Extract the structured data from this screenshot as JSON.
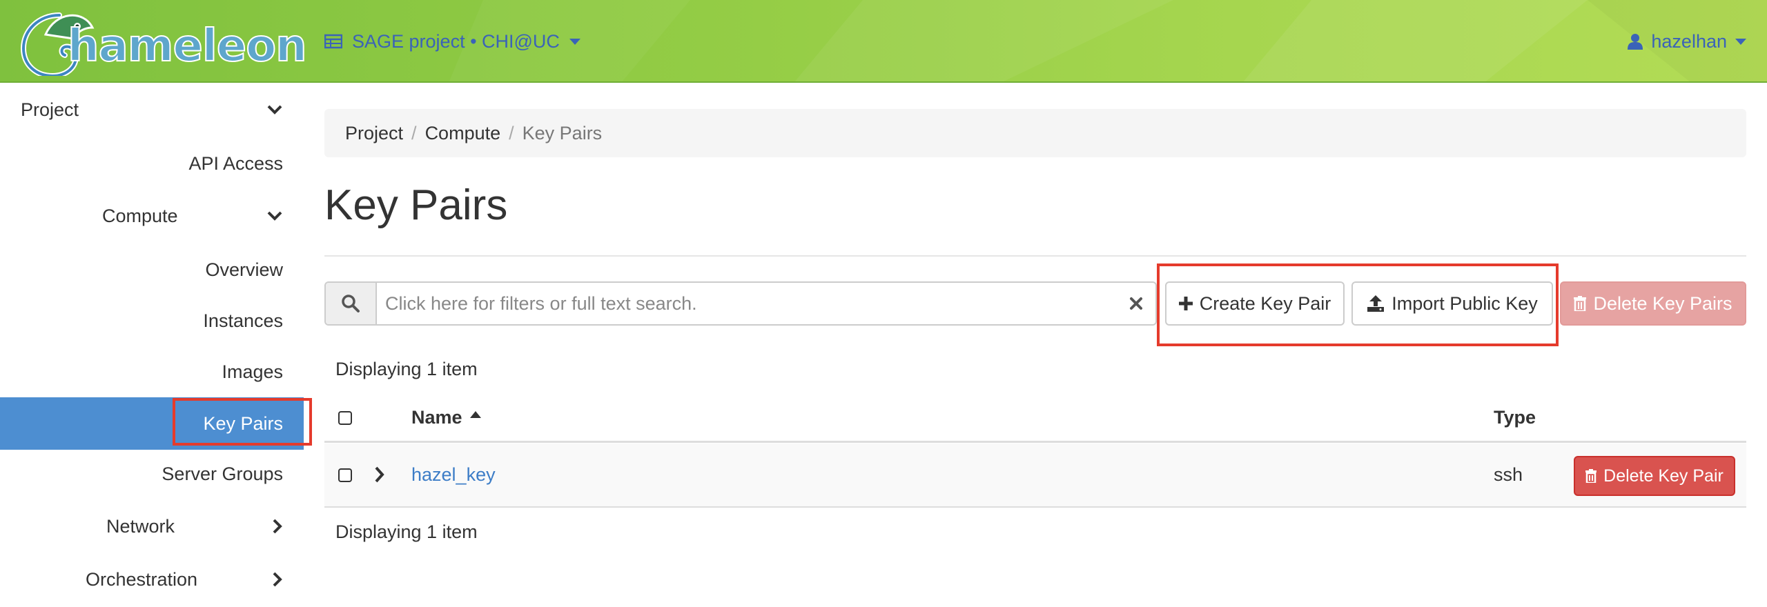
{
  "app": {
    "logo_text": "hameleon"
  },
  "navbar": {
    "project_label": "SAGE project • CHI@UC",
    "user_label": "hazelhan",
    "project_icon": "table-icon",
    "user_icon": "user-icon"
  },
  "sidebar": {
    "items": [
      {
        "label": "Project",
        "chevron": "down"
      },
      {
        "label": "API Access"
      },
      {
        "label": "Compute",
        "chevron": "down"
      },
      {
        "label": "Overview"
      },
      {
        "label": "Instances"
      },
      {
        "label": "Images"
      },
      {
        "label": "Key Pairs",
        "active": true
      },
      {
        "label": "Server Groups"
      },
      {
        "label": "Network",
        "chevron": "right"
      },
      {
        "label": "Orchestration",
        "chevron": "right"
      }
    ],
    "active_color": "#4d8ed1"
  },
  "breadcrumb": {
    "items": [
      "Project",
      "Compute",
      "Key Pairs"
    ],
    "separator": "/"
  },
  "page": {
    "title": "Key Pairs"
  },
  "toolbar": {
    "search_placeholder": "Click here for filters or full text search.",
    "create_label": "Create Key Pair",
    "import_label": "Import Public Key",
    "delete_label": "Delete Key Pairs"
  },
  "table": {
    "count_top": "Displaying 1 item",
    "count_bottom": "Displaying 1 item",
    "columns": [
      "Name",
      "Type"
    ],
    "rows": [
      {
        "name": "hazel_key",
        "type": "ssh",
        "action_label": "Delete Key Pair"
      }
    ]
  },
  "colors": {
    "navbar_green": "#93cc45",
    "link_blue": "#3d7dc7",
    "danger_red": "#d9534f",
    "highlight_red": "#e53b2c"
  }
}
